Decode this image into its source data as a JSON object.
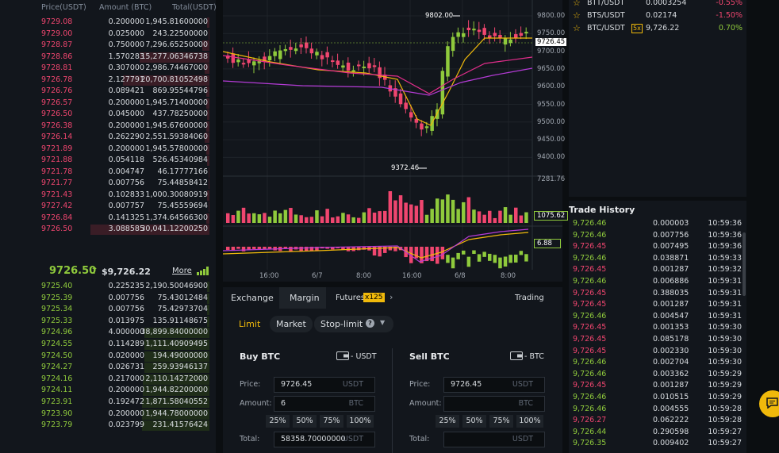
{
  "orderbook": {
    "headers": {
      "price": "Price(USDT)",
      "amount": "Amount (BTC)",
      "total": "Total(USDT)"
    },
    "asks": [
      {
        "price": "9729.08",
        "amount": "0.200000",
        "total": "1,945.81600000",
        "depth": 0.02
      },
      {
        "price": "9729.00",
        "amount": "0.025000",
        "total": "243.22500000",
        "depth": 0.01
      },
      {
        "price": "9728.87",
        "amount": "0.750000",
        "total": "7,296.65250000",
        "depth": 0.06
      },
      {
        "price": "9728.86",
        "amount": "1.570283",
        "total": "15,277.06346738",
        "depth": 0.59
      },
      {
        "price": "9728.81",
        "amount": "0.307000",
        "total": "2,986.74467000",
        "depth": 0.04
      },
      {
        "price": "9726.78",
        "amount": "2.127791",
        "total": "20,700.81052498",
        "depth": 0.73
      },
      {
        "price": "9726.76",
        "amount": "0.089421",
        "total": "869.95544796",
        "depth": 0.03
      },
      {
        "price": "9726.57",
        "amount": "0.200000",
        "total": "1,945.71400000",
        "depth": 0.03
      },
      {
        "price": "9726.50",
        "amount": "0.045000",
        "total": "437.78250000",
        "depth": 0.02
      },
      {
        "price": "9726.38",
        "amount": "0.200000",
        "total": "1,945.67600000",
        "depth": 0.03
      },
      {
        "price": "9726.14",
        "amount": "0.262290",
        "total": "2,551.59384060",
        "depth": 0.04
      },
      {
        "price": "9721.89",
        "amount": "0.200000",
        "total": "1,945.57800000",
        "depth": 0.03
      },
      {
        "price": "9721.88",
        "amount": "0.054118",
        "total": "526.45340984",
        "depth": 0.02
      },
      {
        "price": "9721.78",
        "amount": "0.004747",
        "total": "46.17777166",
        "depth": 0.01
      },
      {
        "price": "9721.77",
        "amount": "0.007756",
        "total": "75.44858412",
        "depth": 0.01
      },
      {
        "price": "9721.43",
        "amount": "0.102833",
        "total": "1,000.30080919",
        "depth": 0.02
      },
      {
        "price": "9727.42",
        "amount": "0.007757",
        "total": "75.45559694",
        "depth": 0.01
      },
      {
        "price": "9726.84",
        "amount": "0.141325",
        "total": "1,374.64566300",
        "depth": 0.03
      },
      {
        "price": "9726.50",
        "amount": "3.088585",
        "total": "30,041.12200250",
        "depth": 1.0
      }
    ],
    "mid": {
      "price": "9726.50",
      "arrow": "↑",
      "usd": "$9,726.22",
      "more": "More"
    },
    "bids": [
      {
        "price": "9725.40",
        "amount": "0.225235",
        "total": "2,190.50046900",
        "depth": 0.02
      },
      {
        "price": "9725.39",
        "amount": "0.007756",
        "total": "75.43012484",
        "depth": 0.02
      },
      {
        "price": "9725.34",
        "amount": "0.007756",
        "total": "75.42973704",
        "depth": 0.02
      },
      {
        "price": "9725.33",
        "amount": "0.013975",
        "total": "135.91148675",
        "depth": 0.02
      },
      {
        "price": "9724.96",
        "amount": "4.000000",
        "total": "38,899.84000000",
        "depth": 0.55
      },
      {
        "price": "9724.55",
        "amount": "0.114289",
        "total": "1,111.40909495",
        "depth": 0.55
      },
      {
        "price": "9724.50",
        "amount": "0.020000",
        "total": "194.49000000",
        "depth": 0.55
      },
      {
        "price": "9724.27",
        "amount": "0.026731",
        "total": "259.93946137",
        "depth": 0.55
      },
      {
        "price": "9724.16",
        "amount": "0.217000",
        "total": "2,110.14272000",
        "depth": 0.56
      },
      {
        "price": "9724.11",
        "amount": "0.200000",
        "total": "1,944.82200000",
        "depth": 0.56
      },
      {
        "price": "9723.91",
        "amount": "0.192472",
        "total": "1,871.58040552",
        "depth": 0.57
      },
      {
        "price": "9723.90",
        "amount": "0.200000",
        "total": "1,944.78000000",
        "depth": 0.57
      },
      {
        "price": "9723.79",
        "amount": "0.023799",
        "total": "231.41576424",
        "depth": 0.57
      }
    ]
  },
  "chart": {
    "high_label": "9802.00",
    "low_label": "9372.46",
    "price_ticks": [
      "9800.00",
      "9750.00",
      "9700.00",
      "9650.00",
      "9600.00",
      "9550.00",
      "9500.00",
      "9450.00",
      "9400.00"
    ],
    "current_price": "9726.45",
    "volume_max": "7281.76",
    "volume_current": "1075.62",
    "macd_current": "6.88",
    "time_ticks": [
      "16:00",
      "6/7",
      "8:00",
      "16:00",
      "6/8",
      "8:00"
    ],
    "colors": {
      "up": "#8fca3c",
      "down": "#f0466f",
      "ma_yellow": "#f0b90b",
      "ma_pink": "#e22d8b",
      "ma_purple": "#b43bd6"
    }
  },
  "tabs": {
    "exchange": "Exchange",
    "margin": "Margin",
    "futures": "Futures",
    "futures_badge": "x125",
    "rules": "Trading Rules"
  },
  "order_types": {
    "limit": "Limit",
    "market": "Market",
    "stop_limit": "Stop-limit"
  },
  "buy": {
    "title": "Buy BTC",
    "balance_unit": "- USDT",
    "price_label": "Price:",
    "price_value": "9726.45",
    "price_unit": "USDT",
    "amount_label": "Amount:",
    "amount_value": "6",
    "amount_unit": "BTC",
    "pcts": [
      "25%",
      "50%",
      "75%",
      "100%"
    ],
    "total_label": "Total:",
    "total_value": "58358.70000000",
    "total_unit": "USDT"
  },
  "sell": {
    "title": "Sell BTC",
    "balance_unit": "- BTC",
    "price_label": "Price:",
    "price_value": "9726.45",
    "price_unit": "USDT",
    "amount_label": "Amount:",
    "amount_value": "",
    "amount_unit": "BTC",
    "pcts": [
      "25%",
      "50%",
      "75%",
      "100%"
    ],
    "total_label": "Total:",
    "total_value": "",
    "total_unit": "USDT"
  },
  "market": [
    {
      "pair": "BTT/USDT",
      "badge": "",
      "price": "0.0003254",
      "change": "-0.55%",
      "dir": "down"
    },
    {
      "pair": "BTS/USDT",
      "badge": "",
      "price": "0.02174",
      "change": "-1.50%",
      "dir": "down"
    },
    {
      "pair": "BTC/USDT",
      "badge": "5x",
      "price": "9,726.22",
      "change": "0.70%",
      "dir": "up"
    }
  ],
  "history": {
    "title": "Trade History",
    "rows": [
      {
        "p": "9,726.46",
        "a": "0.000003",
        "t": "10:59:36",
        "d": "up"
      },
      {
        "p": "9,726.46",
        "a": "0.007756",
        "t": "10:59:36",
        "d": "up"
      },
      {
        "p": "9,726.45",
        "a": "0.007495",
        "t": "10:59:36",
        "d": "down"
      },
      {
        "p": "9,726.46",
        "a": "0.038871",
        "t": "10:59:33",
        "d": "up"
      },
      {
        "p": "9,726.45",
        "a": "0.001287",
        "t": "10:59:32",
        "d": "down"
      },
      {
        "p": "9,726.46",
        "a": "0.006886",
        "t": "10:59:31",
        "d": "up"
      },
      {
        "p": "9,726.45",
        "a": "0.388035",
        "t": "10:59:31",
        "d": "down"
      },
      {
        "p": "9,726.45",
        "a": "0.001287",
        "t": "10:59:31",
        "d": "down"
      },
      {
        "p": "9,726.46",
        "a": "0.004547",
        "t": "10:59:31",
        "d": "up"
      },
      {
        "p": "9,726.45",
        "a": "0.001353",
        "t": "10:59:30",
        "d": "down"
      },
      {
        "p": "9,726.45",
        "a": "0.085178",
        "t": "10:59:30",
        "d": "down"
      },
      {
        "p": "9,726.45",
        "a": "0.002330",
        "t": "10:59:30",
        "d": "down"
      },
      {
        "p": "9,726.46",
        "a": "0.002704",
        "t": "10:59:30",
        "d": "up"
      },
      {
        "p": "9,726.46",
        "a": "0.003362",
        "t": "10:59:29",
        "d": "up"
      },
      {
        "p": "9,726.45",
        "a": "0.001287",
        "t": "10:59:29",
        "d": "down"
      },
      {
        "p": "9,726.46",
        "a": "0.010515",
        "t": "10:59:29",
        "d": "up"
      },
      {
        "p": "9,726.46",
        "a": "0.004555",
        "t": "10:59:28",
        "d": "up"
      },
      {
        "p": "9,726.27",
        "a": "0.062222",
        "t": "10:59:28",
        "d": "down"
      },
      {
        "p": "9,726.44",
        "a": "0.290598",
        "t": "10:59:27",
        "d": "up"
      },
      {
        "p": "9,726.35",
        "a": "0.009402",
        "t": "10:59:27",
        "d": "up"
      }
    ]
  }
}
